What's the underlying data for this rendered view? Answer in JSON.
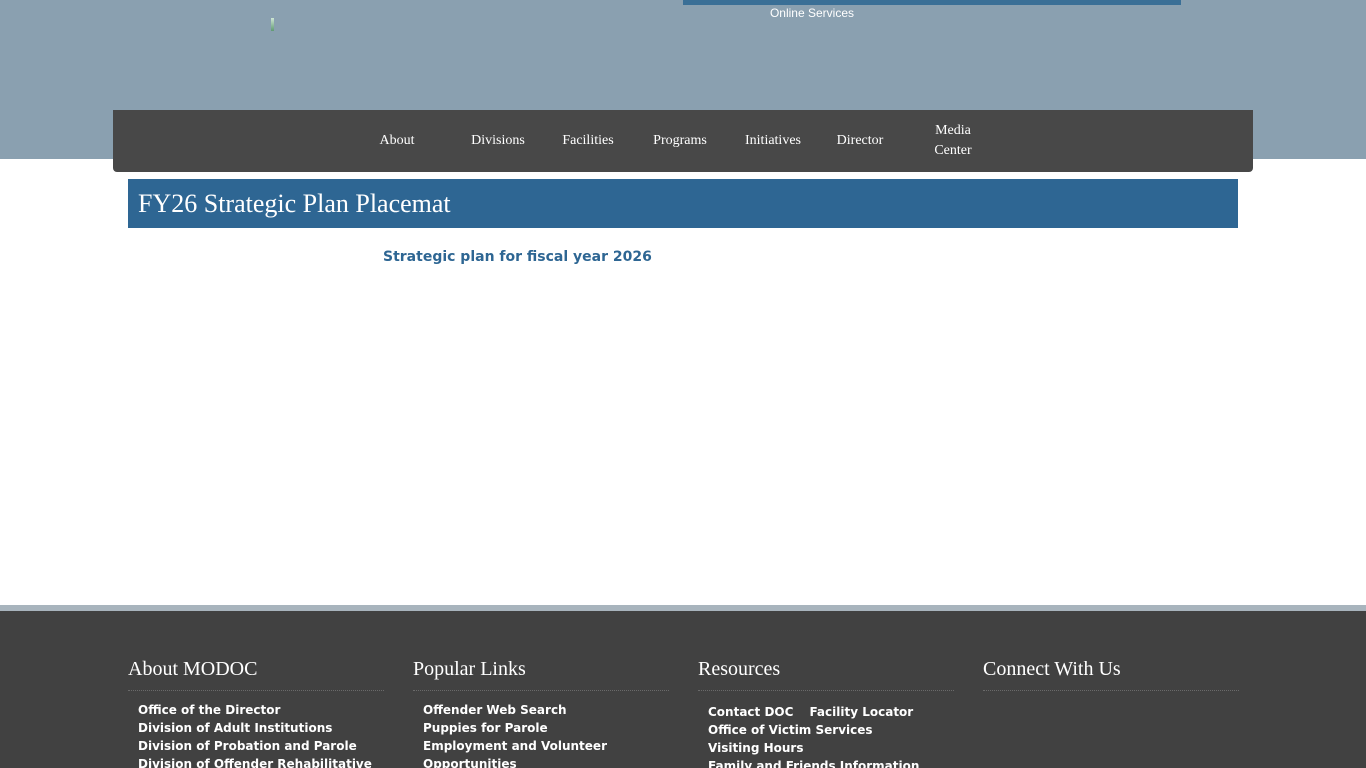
{
  "header": {
    "online_services": "Online Services"
  },
  "nav": {
    "items": [
      {
        "label": "About"
      },
      {
        "label": "Divisions"
      },
      {
        "label": "Facilities"
      },
      {
        "label": "Programs"
      },
      {
        "label": "Initiatives"
      },
      {
        "label": "Director"
      },
      {
        "label": "Media\nCenter"
      }
    ]
  },
  "main": {
    "title": "FY26 Strategic Plan Placemat",
    "image_alt": "Strategic plan for fiscal year 2026"
  },
  "footer": {
    "about": {
      "heading": "About MODOC",
      "links": [
        "Office of the Director",
        "Division of Adult Institutions",
        "Division of Probation and Parole",
        "Division of Offender Rehabilitative"
      ]
    },
    "popular": {
      "heading": "Popular Links",
      "links": [
        "Offender Web Search",
        "Puppies for Parole",
        "Employment and Volunteer",
        "Opportunities"
      ]
    },
    "resources": {
      "heading": "Resources",
      "links": [
        "Contact DOC",
        "Facility Locator",
        "Office of Victim Services",
        "Visiting Hours",
        "Family and Friends Information"
      ]
    },
    "connect": {
      "heading": "Connect With Us"
    }
  },
  "colors": {
    "header_band": "#8aa0b0",
    "nav_background": "#484848",
    "title_bar": "#2e6693",
    "footer_background": "#414141"
  }
}
